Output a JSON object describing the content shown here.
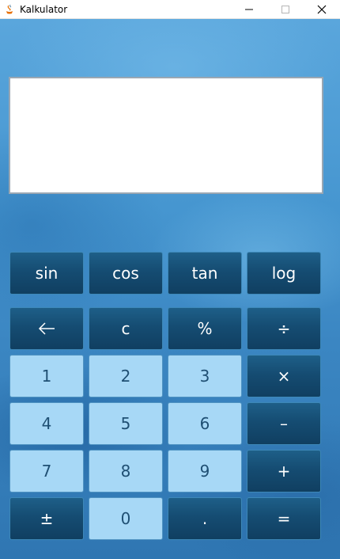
{
  "window": {
    "title": "Kalkulator"
  },
  "display": {
    "value": ""
  },
  "keys": {
    "sin": "sin",
    "cos": "cos",
    "tan": "tan",
    "log": "log",
    "clear": "c",
    "percent": "%",
    "divide": "÷",
    "one": "1",
    "two": "2",
    "three": "3",
    "multiply": "×",
    "four": "4",
    "five": "5",
    "six": "6",
    "minus": "–",
    "seven": "7",
    "eight": "8",
    "nine": "9",
    "plus": "+",
    "plus_minus": "±",
    "zero": "0",
    "decimal": ".",
    "equals": "="
  },
  "icons": {
    "app": "java-icon",
    "minimize": "minimize-icon",
    "maximize": "maximize-icon",
    "close": "close-icon",
    "backspace": "arrow-left-icon"
  },
  "colors": {
    "dark_key": "#154c72",
    "light_key": "#a7d8f6",
    "light_key_text": "#1f4f73",
    "background": "#3f8fc8"
  }
}
